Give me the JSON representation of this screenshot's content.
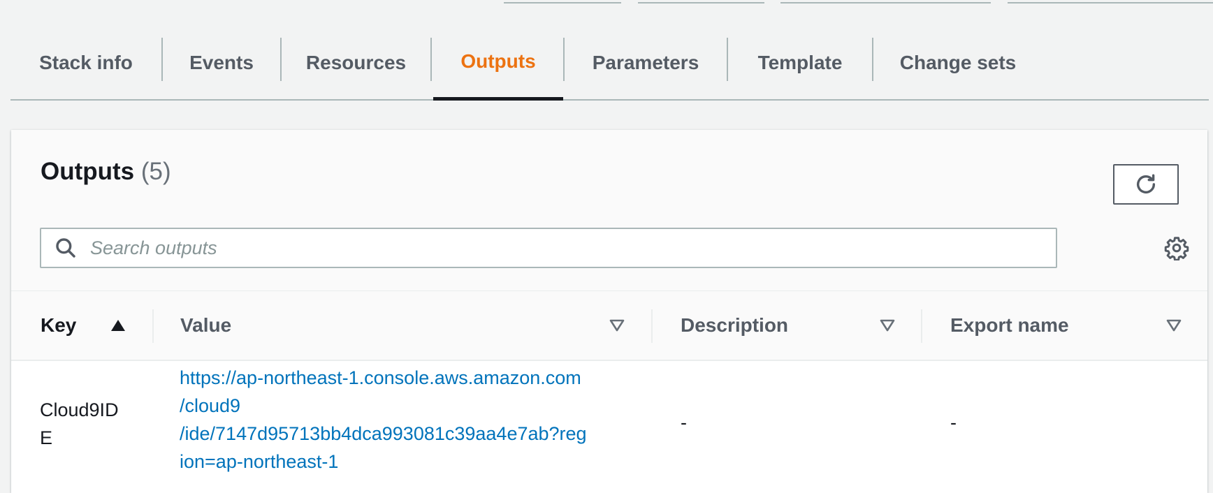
{
  "tabs": [
    {
      "label": "Stack info",
      "active": false
    },
    {
      "label": "Events",
      "active": false
    },
    {
      "label": "Resources",
      "active": false
    },
    {
      "label": "Outputs",
      "active": true
    },
    {
      "label": "Parameters",
      "active": false
    },
    {
      "label": "Template",
      "active": false
    },
    {
      "label": "Change sets",
      "active": false
    }
  ],
  "panel": {
    "title": "Outputs",
    "count": "(5)",
    "refresh_icon": "refresh-icon",
    "settings_icon": "gear-icon"
  },
  "search": {
    "placeholder": "Search outputs",
    "value": "",
    "icon": "search-icon"
  },
  "table": {
    "columns": [
      {
        "label": "Key",
        "sort": "ascending"
      },
      {
        "label": "Value",
        "sort": "none"
      },
      {
        "label": "Description",
        "sort": "none"
      },
      {
        "label": "Export name",
        "sort": "none"
      }
    ],
    "rows": [
      {
        "key": "Cloud9IDE",
        "value_lines": [
          "https://ap-northeast-1.console.aws.amazon.com",
          "/cloud9",
          "/ide/7147d95713bb4dca993081c39aa4e7ab?reg",
          "ion=ap-northeast-1"
        ],
        "description": "-",
        "export_name": "-"
      }
    ]
  },
  "colors": {
    "accent": "#ec7211",
    "link": "#0073bb",
    "text": "#16191f",
    "muted": "#545b64",
    "border": "#aab7b8",
    "background": "#f2f3f3"
  }
}
